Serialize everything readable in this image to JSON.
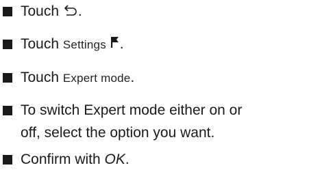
{
  "steps": [
    {
      "prefix": "Touch ",
      "icon": "back-arrow-icon",
      "suffix": "."
    },
    {
      "prefix": "Touch ",
      "ui_label": "Settings",
      "icon": "flag-icon",
      "suffix": "."
    },
    {
      "prefix": "Touch ",
      "ui_label": "Expert mode",
      "suffix": "."
    },
    {
      "line1": "To switch Expert mode either on or",
      "line2": "off, select the option you want."
    },
    {
      "prefix": "Confirm with ",
      "emphasis": "OK",
      "suffix": "."
    }
  ]
}
